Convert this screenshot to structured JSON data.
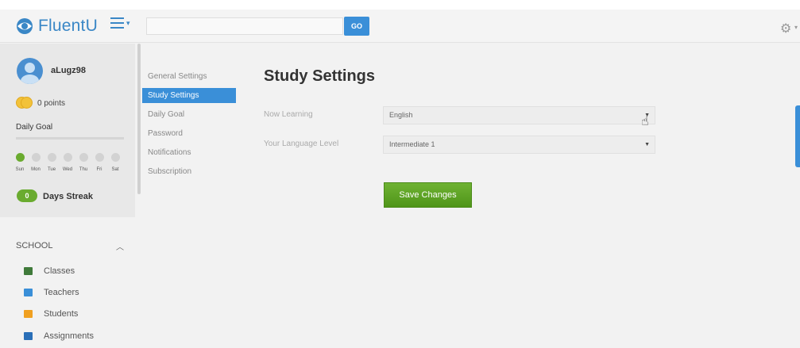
{
  "header": {
    "brand": "FluentU",
    "search_placeholder": "",
    "go_label": "GO",
    "settings_icon": "gear-icon"
  },
  "profile": {
    "username": "aLugz98",
    "points": "0 points",
    "daily_goal_label": "Daily Goal",
    "week_days": [
      "Sun",
      "Mon",
      "Tue",
      "Wed",
      "Thu",
      "Fri",
      "Sat"
    ],
    "active_day_index": 0,
    "streak_count": "0",
    "streak_label": "Days Streak"
  },
  "school": {
    "header": "SCHOOL",
    "items": [
      {
        "label": "Classes",
        "icon": "classes-icon",
        "color": "#3f7a3a"
      },
      {
        "label": "Teachers",
        "icon": "teachers-icon",
        "color": "#3a8fd8"
      },
      {
        "label": "Students",
        "icon": "students-icon",
        "color": "#f0a020"
      },
      {
        "label": "Assignments",
        "icon": "assignments-icon",
        "color": "#2a6fb8"
      }
    ]
  },
  "settings_nav": {
    "items": [
      {
        "label": "General Settings",
        "active": false
      },
      {
        "label": "Study Settings",
        "active": true
      },
      {
        "label": "Daily Goal",
        "active": false
      },
      {
        "label": "Password",
        "active": false
      },
      {
        "label": "Notifications",
        "active": false
      },
      {
        "label": "Subscription",
        "active": false
      }
    ]
  },
  "main": {
    "title": "Study Settings",
    "now_learning_label": "Now Learning",
    "now_learning_value": "English",
    "level_label": "Your Language Level",
    "level_value": "Intermediate 1",
    "save_label": "Save Changes"
  },
  "colors": {
    "accent": "#3a8fd8",
    "brand": "#3a87c6",
    "success": "#5ca326"
  }
}
